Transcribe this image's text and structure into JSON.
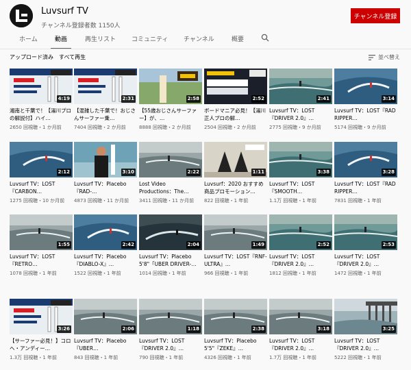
{
  "channel": {
    "name": "Luvsurf TV",
    "subscribers": "チャンネル登録者数 1150人",
    "subscribe_label": "チャンネル登録"
  },
  "tabs": [
    {
      "label": "ホーム",
      "active": false
    },
    {
      "label": "動画",
      "active": true
    },
    {
      "label": "再生リスト",
      "active": false
    },
    {
      "label": "コミュニティ",
      "active": false
    },
    {
      "label": "チャンネル",
      "active": false
    },
    {
      "label": "概要",
      "active": false
    }
  ],
  "filter_bar": {
    "uploads_label": "アップロード済み",
    "play_all_label": "すべて再生",
    "sort_label": "並べ替え"
  },
  "colors": {
    "subscribe": "#cc0000",
    "duration_bg": "#000000"
  },
  "videos": [
    {
      "title": "湘南と千葉で！【湯川プロの解説付】ハイ…",
      "meta": "2650 回視聴・1 か月前",
      "duration": "4:19",
      "thumb": "promo-white",
      "thumb_text": "LIGHT SPEED"
    },
    {
      "title": "【混雑した千葉で！おじさんサーファー乗…",
      "meta": "7404 回視聴・2 か月前",
      "duration": "2:31",
      "thumb": "promo-white",
      "thumb_text": "LIGHT SPEED"
    },
    {
      "title": "【55歳おじさんサーファー】が、…",
      "meta": "8888 回視聴・2 か月前",
      "duration": "2:58",
      "thumb": "promo-outdoor",
      "thumb_text": "55歳"
    },
    {
      "title": "ボードマニア必見！【湯川正人プロの解…",
      "meta": "2504 回視聴・2 か月前",
      "duration": "2:52",
      "thumb": "promo-dark",
      "thumb_text": "LIGHT SPEED"
    },
    {
      "title": "Luvsurf TV：LOST『DRIVER 2.0』…",
      "meta": "2775 回視聴・9 か月前",
      "duration": "2:41",
      "thumb": "wave-green"
    },
    {
      "title": "Luvsurf TV：LOST『RAD RIPPER…",
      "meta": "5174 回視聴・9 か月前",
      "duration": "3:14",
      "thumb": "wave-blue"
    },
    {
      "title": "Luvsurf TV：LOST『CARBON…",
      "meta": "1275 回視聴・10 か月前",
      "duration": "2:12",
      "thumb": "wave-blue"
    },
    {
      "title": "Luvsurf TV：Placebo『RAD-…",
      "meta": "4873 回視聴・11 か月前",
      "duration": "3:10",
      "thumb": "person"
    },
    {
      "title": "Lost Video Productions：The…",
      "meta": "3411 回視聴・11 か月前",
      "duration": "2:22",
      "thumb": "wave-grey"
    },
    {
      "title": "Luvsurf：2020 おすすめ商品プロモーション…",
      "meta": "822 回視聴・1 年前",
      "duration": "1:11",
      "thumb": "fins"
    },
    {
      "title": "Luvsurf TV：LOST『SMOOTH…",
      "meta": "1.1万 回視聴・1 年前",
      "duration": "3:38",
      "thumb": "wave-green"
    },
    {
      "title": "Luvsurf TV：LOST『RAD RIPPER…",
      "meta": "7831 回視聴・1 年前",
      "duration": "3:28",
      "thumb": "wave-blue"
    },
    {
      "title": "Luvsurf TV：LOST『RETRO…",
      "meta": "1078 回視聴・1 年前",
      "duration": "1:55",
      "thumb": "wave-grey"
    },
    {
      "title": "Luvsurf TV：Placebo『DIABLO-X』…",
      "meta": "1522 回視聴・1 年前",
      "duration": "2:42",
      "thumb": "wave-blue"
    },
    {
      "title": "Luvsurf TV：Placebo 5'8\"「UBER DRIVER-…",
      "meta": "1014 回視聴・1 年前",
      "duration": "2:04",
      "thumb": "wave-dark"
    },
    {
      "title": "Luvsurf TV：LOST『RNF-ULTRA』…",
      "meta": "966 回視聴・1 年前",
      "duration": "1:49",
      "thumb": "wave-grey"
    },
    {
      "title": "Luvsurf TV：LOST『DRIVER 2.0』…",
      "meta": "1812 回視聴・1 年前",
      "duration": "2:52",
      "thumb": "wave-green"
    },
    {
      "title": "Luvsurf TV：LOST『DRIVER 2.0』…",
      "meta": "1472 回視聴・1 年前",
      "duration": "2:53",
      "thumb": "wave-green"
    },
    {
      "title": "【サーファー必見！】コロヘ・アンディー…",
      "meta": "1.3万 回視聴・1 年前",
      "duration": "3:26",
      "thumb": "promo-white",
      "thumb_text": "サーファー必見"
    },
    {
      "title": "Luvsurf TV：Placebo『UBER…",
      "meta": "843 回視聴・1 年前",
      "duration": "2:06",
      "thumb": "wave-grey"
    },
    {
      "title": "Luvsurf TV：LOST『DRIVER 2.0』…",
      "meta": "790 回視聴・1 年前",
      "duration": "1:18",
      "thumb": "wave-grey"
    },
    {
      "title": "Luvsurf TV：Placebo 5'5\"『ZEKE』…",
      "meta": "4326 回視聴・1 年前",
      "duration": "2:38",
      "thumb": "wave-grey"
    },
    {
      "title": "Luvsurf TV：LOST『DRIVER 2.0』…",
      "meta": "1.7万 回視聴・1 年前",
      "duration": "3:18",
      "thumb": "wave-grey"
    },
    {
      "title": "Luvsurf TV：LOST『DRIVER 2.0』…",
      "meta": "5222 回視聴・1 年前",
      "duration": "3:25",
      "thumb": "pier"
    }
  ]
}
